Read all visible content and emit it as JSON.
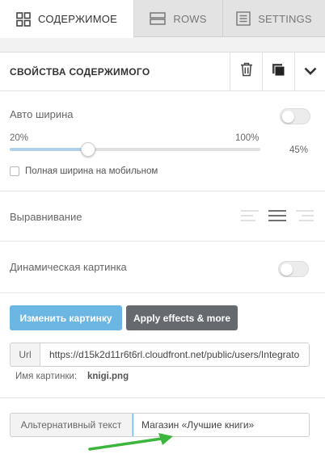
{
  "tabs": [
    {
      "label": "СОДЕРЖИМОЕ",
      "icon": "grid-icon",
      "active": true
    },
    {
      "label": "ROWS",
      "icon": "rows-icon",
      "active": false
    },
    {
      "label": "SETTINGS",
      "icon": "settings-doc-icon",
      "active": false
    }
  ],
  "panel": {
    "title": "СВОЙСТВА СОДЕРЖИМОГО",
    "icons": [
      "trash-icon",
      "duplicate-icon",
      "chevron-down-icon"
    ]
  },
  "width": {
    "label": "Авто ширина",
    "auto_enabled": false,
    "min_label": "20%",
    "max_label": "100%",
    "value_label": "45%",
    "value": 45,
    "min": 20,
    "max": 100,
    "mobile_full_label": "Полная ширина на мобильном",
    "mobile_full_checked": false
  },
  "alignment": {
    "label": "Выравнивание",
    "options": [
      "align-left-icon",
      "align-center-icon",
      "align-right-icon"
    ],
    "selected": "align-center-icon"
  },
  "dynamic": {
    "label": "Динамическая картинка",
    "enabled": false
  },
  "image": {
    "change_button": "Изменить картинку",
    "effects_button": "Apply effects & more",
    "url_label": "Url",
    "url_value": "https://d15k2d11r6t6rl.cloudfront.net/public/users/Integrato",
    "name_label": "Имя картинки:",
    "name_value": "knigi.png"
  },
  "alt": {
    "label": "Альтернативный текст",
    "value": "Магазин «Лучшие книги»"
  },
  "colors": {
    "accent_blue": "#6cb6e3",
    "dark_button": "#666a6e",
    "annotation_arrow": "#3cb53c"
  }
}
